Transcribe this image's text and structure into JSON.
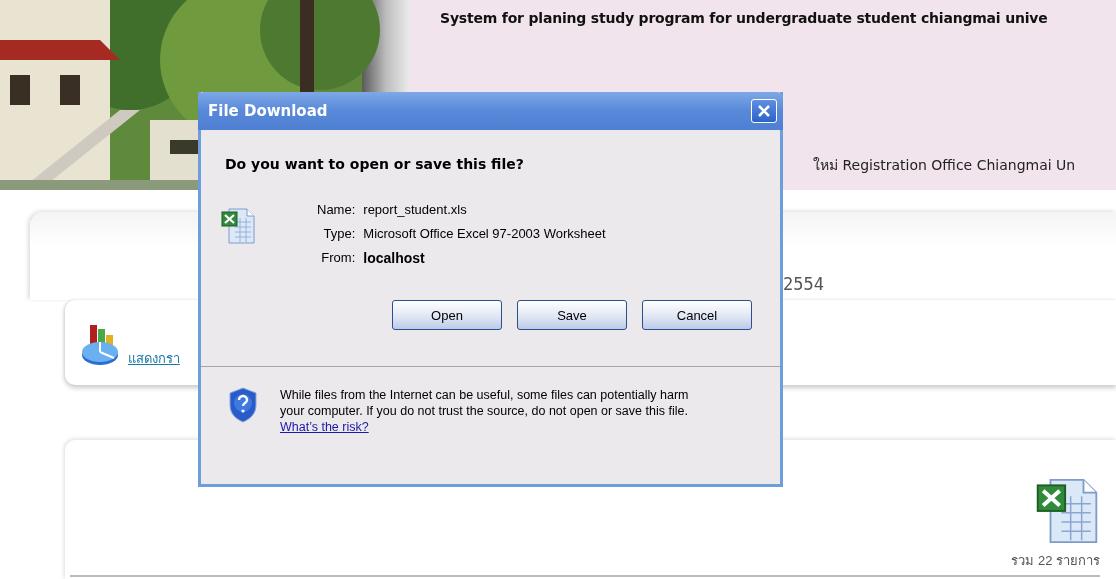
{
  "header": {
    "title": "System for planing study program for undergraduate student chiangmai unive",
    "subtitle": "ใหม่ Registration Office Chiangmai Un"
  },
  "page": {
    "year_text": "2554",
    "chart_link": "แสดงกรา",
    "total_count": "รวม 22 รายการ"
  },
  "dialog": {
    "title": "File Download",
    "question": "Do you want to open or save this file?",
    "fields": [
      {
        "label": "Name:",
        "value": "report_student.xls",
        "bold": false
      },
      {
        "label": "Type:",
        "value": "Microsoft Office Excel 97-2003 Worksheet",
        "bold": false
      },
      {
        "label": "From:",
        "value": "localhost",
        "bold": true
      }
    ],
    "buttons": [
      "Open",
      "Save",
      "Cancel"
    ],
    "warning": "While files from the Internet can be useful, some files can potentially harm your computer. If you do not trust the source, do not open or save this file.",
    "risk_link": "What’s the risk?"
  }
}
